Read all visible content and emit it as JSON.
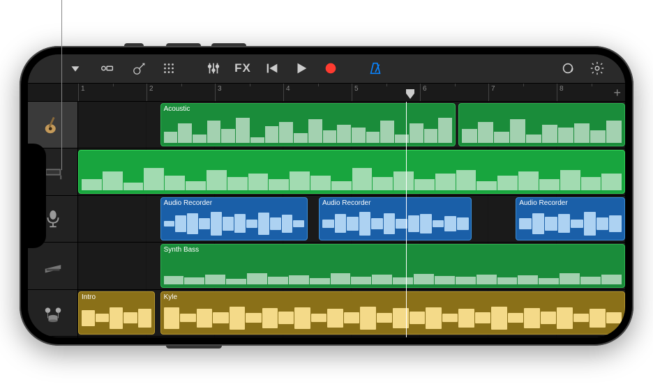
{
  "toolbar": {
    "browser_icon": "browser",
    "dock_icon": "dock",
    "instrument_icon": "guitar",
    "grid_icon": "grid",
    "mixer_icon": "sliders",
    "fx_label": "FX",
    "rewind_icon": "rewind",
    "play_icon": "play",
    "record_icon": "record",
    "metronome_icon": "metronome",
    "loop_icon": "loop",
    "settings_icon": "gear"
  },
  "ruler": {
    "bars": [
      "1",
      "2",
      "3",
      "4",
      "5",
      "6",
      "7",
      "8"
    ],
    "playhead_bar": 5,
    "add_label": "+"
  },
  "tracks": [
    {
      "name": "Acoustic",
      "icon": "acoustic-guitar",
      "selected": true,
      "regions": [
        {
          "label": "Acoustic",
          "start": 15,
          "end": 69,
          "color": "green"
        },
        {
          "label": "",
          "start": 69.5,
          "end": 100,
          "color": "green"
        }
      ]
    },
    {
      "name": "Keys",
      "icon": "keyboard",
      "selected": false,
      "regions": [
        {
          "label": "",
          "start": 0,
          "end": 100,
          "color": "green2"
        }
      ]
    },
    {
      "name": "Audio Recorder",
      "icon": "microphone",
      "selected": false,
      "regions": [
        {
          "label": "Audio Recorder",
          "start": 15,
          "end": 42,
          "color": "blue"
        },
        {
          "label": "Audio Recorder",
          "start": 44,
          "end": 72,
          "color": "blue"
        },
        {
          "label": "Audio Recorder",
          "start": 80,
          "end": 100,
          "color": "blue"
        }
      ]
    },
    {
      "name": "Synth Bass",
      "icon": "synth",
      "selected": false,
      "regions": [
        {
          "label": "Synth Bass",
          "start": 15,
          "end": 100,
          "color": "green"
        }
      ]
    },
    {
      "name": "Drums",
      "icon": "drums",
      "selected": false,
      "regions": [
        {
          "label": "Intro",
          "start": 0,
          "end": 14,
          "color": "gold"
        },
        {
          "label": "Kyle",
          "start": 15,
          "end": 100,
          "color": "gold"
        }
      ]
    }
  ]
}
